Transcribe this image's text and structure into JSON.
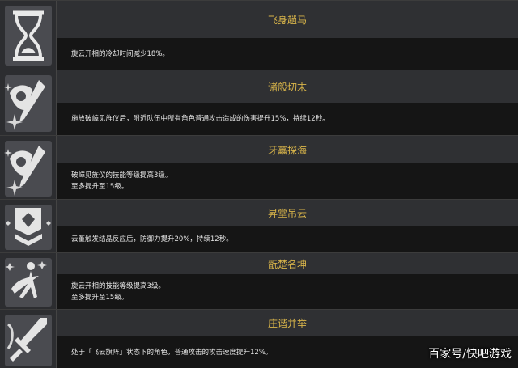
{
  "talents": [
    {
      "name": "飞身趟马",
      "icon": "hourglass-icon",
      "desc": [
        "旋云开相的冷却时间减少18%。"
      ]
    },
    {
      "name": "诸般切末",
      "icon": "fan-spear-icon",
      "desc": [
        "施放破嶂见旌仪后，附近队伍中所有角色普通攻击造成的伤害提升15%，持续12秒。"
      ]
    },
    {
      "name": "牙靐探海",
      "icon": "fan-spear-icon",
      "desc": [
        "破嶂见旌仪的技能等级提高3级。",
        "至多提升至15级。"
      ]
    },
    {
      "name": "昇堂吊云",
      "icon": "shield-rank-icon",
      "desc": [
        "云堇触发结晶反应后，防御力提升20%，持续12秒。"
      ]
    },
    {
      "name": "翫楚名坤",
      "icon": "dancer-icon",
      "desc": [
        "旋云开相的技能等级提高3级。",
        "至多提升至15级。"
      ]
    },
    {
      "name": "庄谐并举",
      "icon": "sword-icon",
      "desc": [
        "处于「飞云旗阵」状态下的角色，普通攻击的攻击速度提升12%。"
      ]
    }
  ],
  "watermark": "百家号/快吧游戏"
}
